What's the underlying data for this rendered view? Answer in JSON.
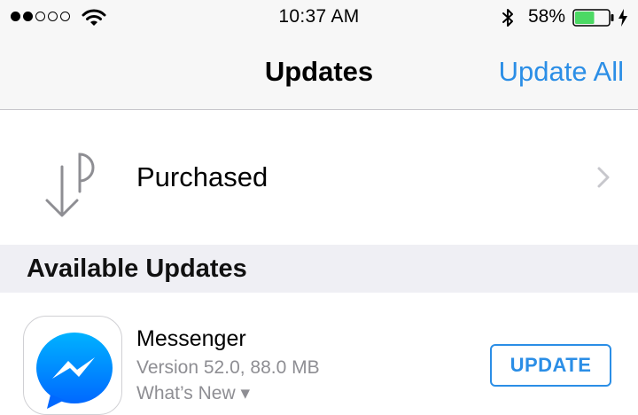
{
  "status_bar": {
    "signal_filled": 2,
    "signal_total": 5,
    "time": "10:37 AM",
    "battery_percent": "58%",
    "battery_level": 0.58,
    "battery_color": "#4cd964"
  },
  "nav": {
    "title": "Updates",
    "update_all_label": "Update All"
  },
  "purchased": {
    "label": "Purchased"
  },
  "section": {
    "title": "Available Updates"
  },
  "apps": [
    {
      "name": "Messenger",
      "version": "Version 52.0, 88.0 MB",
      "whats_new": "What’s New ▾",
      "button_label": "UPDATE"
    }
  ],
  "colors": {
    "accent": "#2b8ee6",
    "bar_background": "#f7f7f7",
    "section_background": "#efeff4",
    "secondary_text": "#8e8e93"
  },
  "icons": [
    "wifi-icon",
    "bluetooth-icon",
    "battery-icon",
    "charging-bolt-icon",
    "purchased-icon",
    "chevron-right-icon",
    "messenger-app-icon"
  ]
}
